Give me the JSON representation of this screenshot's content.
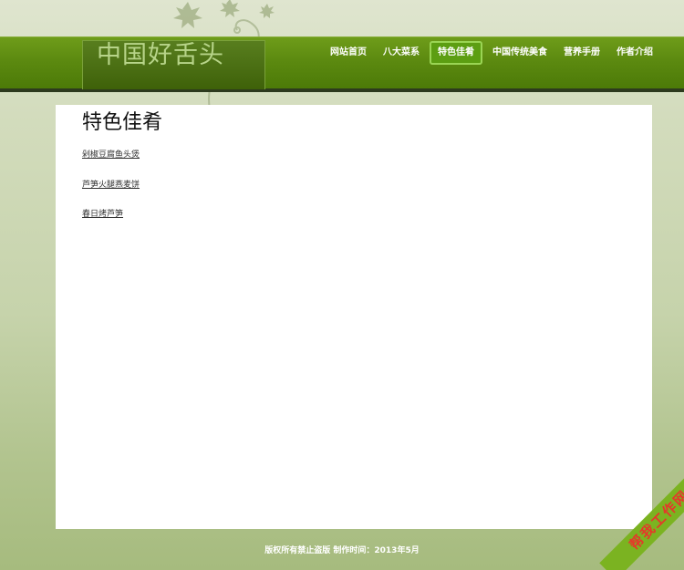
{
  "site": {
    "logo_text": "中国好舌头"
  },
  "nav": {
    "items": [
      {
        "label": "网站首页"
      },
      {
        "label": "八大菜系"
      },
      {
        "label": "特色佳肴"
      },
      {
        "label": "中国传统美食"
      },
      {
        "label": "营养手册"
      },
      {
        "label": "作者介绍"
      }
    ],
    "active_index": 2
  },
  "main": {
    "title": "特色佳肴",
    "dishes": [
      {
        "label": "剁椒豆腐鱼头煲"
      },
      {
        "label": "芦笋火腿燕麦饼"
      },
      {
        "label": "春日烤芦笋"
      }
    ]
  },
  "footer": {
    "text": "版权所有禁止盗版  制作时间：2013年5月"
  },
  "ribbon": {
    "text": "帮我工作网"
  },
  "colors": {
    "header_green": "#5c8a10",
    "logo_text": "#b7d489",
    "active_nav": "#5c9e12",
    "ribbon_bg": "#7bb321",
    "ribbon_text": "#e6372a"
  }
}
